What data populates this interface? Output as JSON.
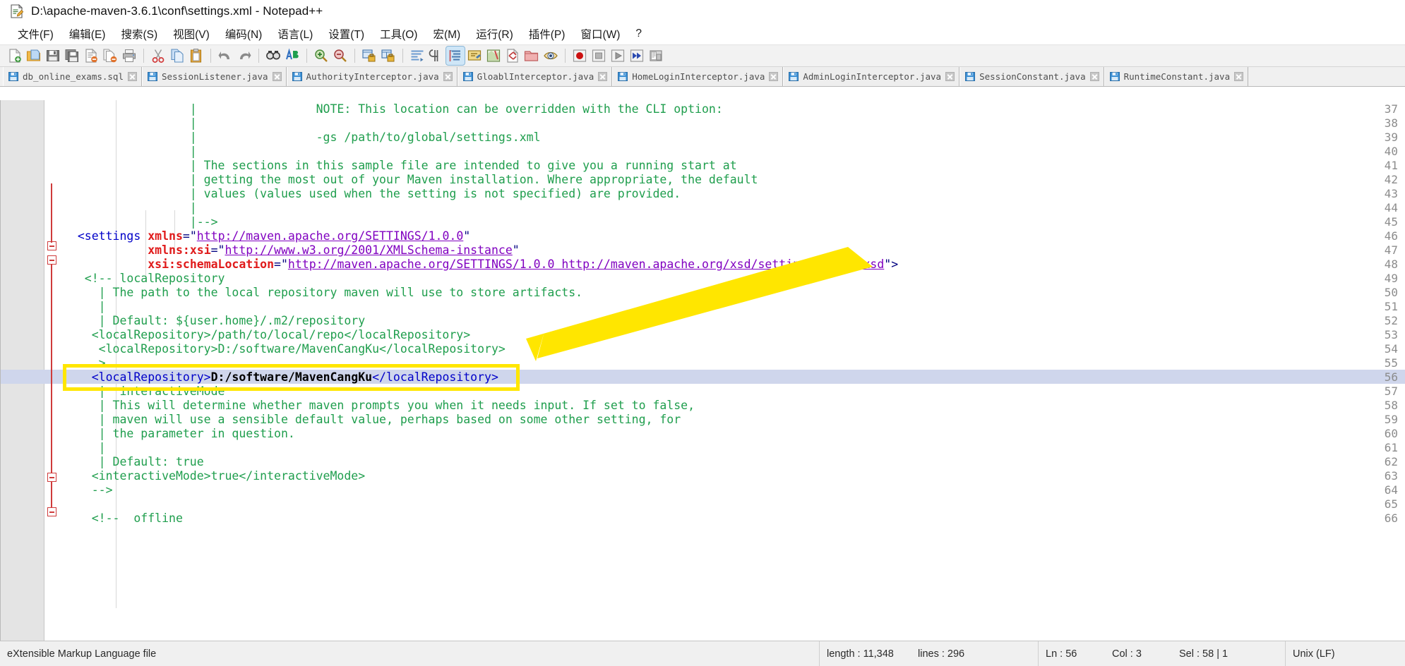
{
  "window": {
    "title": "D:\\apache-maven-3.6.1\\conf\\settings.xml - Notepad++",
    "icon": "notepad-plus-plus-icon"
  },
  "menu": {
    "items": [
      {
        "label": "文件(F)",
        "name": "menu-file"
      },
      {
        "label": "编辑(E)",
        "name": "menu-edit"
      },
      {
        "label": "搜索(S)",
        "name": "menu-search"
      },
      {
        "label": "视图(V)",
        "name": "menu-view"
      },
      {
        "label": "编码(N)",
        "name": "menu-encoding"
      },
      {
        "label": "语言(L)",
        "name": "menu-language"
      },
      {
        "label": "设置(T)",
        "name": "menu-settings"
      },
      {
        "label": "工具(O)",
        "name": "menu-tools"
      },
      {
        "label": "宏(M)",
        "name": "menu-macro"
      },
      {
        "label": "运行(R)",
        "name": "menu-run"
      },
      {
        "label": "插件(P)",
        "name": "menu-plugins"
      },
      {
        "label": "窗口(W)",
        "name": "menu-window"
      },
      {
        "label": "?",
        "name": "menu-help"
      }
    ]
  },
  "toolbar": {
    "buttons": [
      {
        "icon": "new-file-icon"
      },
      {
        "icon": "open-folder-icon"
      },
      {
        "icon": "save-icon"
      },
      {
        "icon": "save-all-icon"
      },
      {
        "icon": "close-file-icon"
      },
      {
        "icon": "close-all-icon"
      },
      {
        "icon": "print-icon"
      },
      {
        "sep": true
      },
      {
        "icon": "cut-icon"
      },
      {
        "icon": "copy-icon"
      },
      {
        "icon": "paste-icon"
      },
      {
        "sep": true
      },
      {
        "icon": "undo-icon"
      },
      {
        "icon": "redo-icon"
      },
      {
        "sep": true
      },
      {
        "icon": "find-icon"
      },
      {
        "icon": "replace-icon"
      },
      {
        "sep": true
      },
      {
        "icon": "zoom-in-icon"
      },
      {
        "icon": "zoom-out-icon"
      },
      {
        "sep": true
      },
      {
        "icon": "sync-vertical-scroll-icon"
      },
      {
        "icon": "sync-horizontal-scroll-icon"
      },
      {
        "sep": true
      },
      {
        "icon": "word-wrap-icon"
      },
      {
        "icon": "show-all-characters-icon"
      },
      {
        "icon": "indent-guideline-icon",
        "active": true
      },
      {
        "icon": "user-defined-language-icon"
      },
      {
        "sep": false
      },
      {
        "icon": "document-map-icon"
      },
      {
        "icon": "function-list-icon"
      },
      {
        "icon": "folder-as-workspace-icon"
      },
      {
        "icon": "monitoring-icon"
      },
      {
        "sep": true
      },
      {
        "icon": "record-macro-icon"
      },
      {
        "icon": "stop-recording-icon"
      },
      {
        "icon": "play-macro-icon"
      },
      {
        "icon": "run-macro-multiple-icon"
      },
      {
        "icon": "run-icon"
      }
    ]
  },
  "tabs": [
    {
      "label": "db_online_exams.sql",
      "icon": "saved-file-icon"
    },
    {
      "label": "SessionListener.java",
      "icon": "saved-file-icon"
    },
    {
      "label": "AuthorityInterceptor.java",
      "icon": "saved-file-icon"
    },
    {
      "label": "GloablInterceptor.java",
      "icon": "saved-file-icon"
    },
    {
      "label": "HomeLoginInterceptor.java",
      "icon": "saved-file-icon"
    },
    {
      "label": "AdminLoginInterceptor.java",
      "icon": "saved-file-icon"
    },
    {
      "label": "SessionConstant.java",
      "icon": "saved-file-icon"
    },
    {
      "label": "RuntimeConstant.java",
      "icon": "saved-file-icon"
    }
  ],
  "editor": {
    "first_line": 37,
    "highlighted_line": 56,
    "lines": [
      {
        "n": 37,
        "segments": [
          {
            "t": "                  |                 NOTE: This location can be overridden with the CLI option:",
            "c": "cmt"
          }
        ]
      },
      {
        "n": 38,
        "segments": [
          {
            "t": "                  |",
            "c": "cmt"
          }
        ]
      },
      {
        "n": 39,
        "segments": [
          {
            "t": "                  |                 -gs /path/to/global/settings.xml",
            "c": "cmt"
          }
        ]
      },
      {
        "n": 40,
        "segments": [
          {
            "t": "                  |",
            "c": "cmt"
          }
        ]
      },
      {
        "n": 41,
        "segments": [
          {
            "t": "                  | The sections in this sample file are intended to give you a running start at",
            "c": "cmt"
          }
        ]
      },
      {
        "n": 42,
        "segments": [
          {
            "t": "                  | getting the most out of your Maven installation. Where appropriate, the default",
            "c": "cmt"
          }
        ]
      },
      {
        "n": 43,
        "segments": [
          {
            "t": "                  | values (values used when the setting is not specified) are provided.",
            "c": "cmt"
          }
        ]
      },
      {
        "n": 44,
        "segments": [
          {
            "t": "                  |",
            "c": "cmt"
          }
        ]
      },
      {
        "n": 45,
        "segments": [
          {
            "t": "                  |-->",
            "c": "cmt"
          }
        ]
      },
      {
        "n": 46,
        "segments": [
          {
            "t": "  <settings ",
            "c": "tag"
          },
          {
            "t": "xmlns",
            "c": "attr"
          },
          {
            "t": "=\"",
            "c": "qt"
          },
          {
            "t": "http://maven.apache.org/SETTINGS/1.0.0",
            "c": "val"
          },
          {
            "t": "\"",
            "c": "qt"
          }
        ]
      },
      {
        "n": 47,
        "segments": [
          {
            "t": "            ",
            "c": "tag"
          },
          {
            "t": "xmlns:xsi",
            "c": "attr"
          },
          {
            "t": "=\"",
            "c": "qt"
          },
          {
            "t": "http://www.w3.org/2001/XMLSchema-instance",
            "c": "val"
          },
          {
            "t": "\"",
            "c": "qt"
          }
        ]
      },
      {
        "n": 48,
        "segments": [
          {
            "t": "            ",
            "c": "tag"
          },
          {
            "t": "xsi:schemaLocation",
            "c": "attr"
          },
          {
            "t": "=\"",
            "c": "qt"
          },
          {
            "t": "http://maven.apache.org/SETTINGS/1.0.0 http://maven.apache.org/xsd/settings-1.0.0.xsd",
            "c": "val"
          },
          {
            "t": "\">",
            "c": "qt"
          }
        ]
      },
      {
        "n": 49,
        "segments": [
          {
            "t": "   <!-- localRepository",
            "c": "cmt"
          }
        ]
      },
      {
        "n": 50,
        "segments": [
          {
            "t": "     | The path to the local repository maven will use to store artifacts.",
            "c": "cmt"
          }
        ]
      },
      {
        "n": 51,
        "segments": [
          {
            "t": "     |",
            "c": "cmt"
          }
        ]
      },
      {
        "n": 52,
        "segments": [
          {
            "t": "     | Default: ${user.home}/.m2/repository",
            "c": "cmt"
          }
        ]
      },
      {
        "n": 53,
        "segments": [
          {
            "t": "    <localRepository>/path/to/local/repo</localRepository>",
            "c": "cmt"
          }
        ]
      },
      {
        "n": 54,
        "segments": [
          {
            "t": "     <localRepository>D:/software/MavenCangKu</localRepository>",
            "c": "cmt"
          }
        ]
      },
      {
        "n": 55,
        "segments": [
          {
            "t": "     >",
            "c": "cmt"
          }
        ]
      },
      {
        "n": 56,
        "segments": [
          {
            "t": "    <localRepository>",
            "c": "tag"
          },
          {
            "t": "D:/software/MavenCangKu",
            "c": "txt"
          },
          {
            "t": "</localRepository>",
            "c": "tag"
          }
        ]
      },
      {
        "n": 57,
        "segments": [
          {
            "t": "     |  interactiveMode",
            "c": "cmt"
          }
        ]
      },
      {
        "n": 58,
        "segments": [
          {
            "t": "     | This will determine whether maven prompts you when it needs input. If set to false,",
            "c": "cmt"
          }
        ]
      },
      {
        "n": 59,
        "segments": [
          {
            "t": "     | maven will use a sensible default value, perhaps based on some other setting, for",
            "c": "cmt"
          }
        ]
      },
      {
        "n": 60,
        "segments": [
          {
            "t": "     | the parameter in question.",
            "c": "cmt"
          }
        ]
      },
      {
        "n": 61,
        "segments": [
          {
            "t": "     |",
            "c": "cmt"
          }
        ]
      },
      {
        "n": 62,
        "segments": [
          {
            "t": "     | Default: true",
            "c": "cmt"
          }
        ]
      },
      {
        "n": 63,
        "segments": [
          {
            "t": "    <interactiveMode>true</interactiveMode>",
            "c": "cmt"
          }
        ]
      },
      {
        "n": 64,
        "segments": [
          {
            "t": "    -->",
            "c": "cmt"
          }
        ]
      },
      {
        "n": 65,
        "segments": [
          {
            "t": "",
            "c": "cmt"
          }
        ]
      },
      {
        "n": 66,
        "segments": [
          {
            "t": "    <!--  offline",
            "c": "cmt"
          }
        ]
      }
    ]
  },
  "annotation": {
    "box_color": "#ffe600",
    "arrow_color": "#ffe600",
    "target_line": 56
  },
  "statusbar": {
    "language": "eXtensible Markup Language file",
    "length_label": "length : 11,348",
    "lines_label": "lines : 296",
    "ln": "Ln : 56",
    "col": "Col : 3",
    "sel": "Sel : 58 | 1",
    "eol": "Unix (LF)"
  }
}
